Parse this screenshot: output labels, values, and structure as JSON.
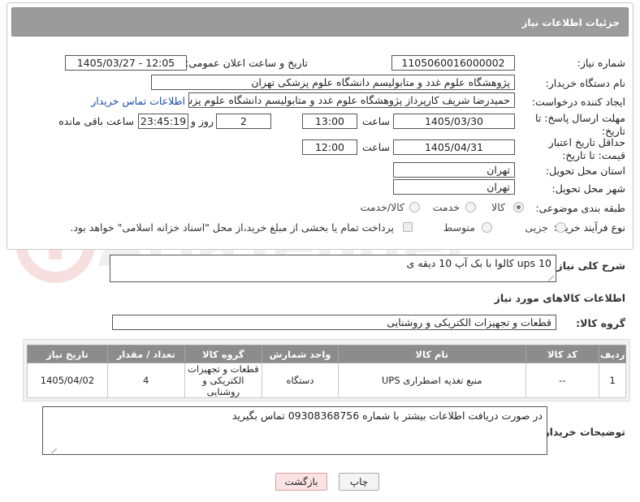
{
  "header": {
    "title": "جزئیات اطلاعات نیاز"
  },
  "fields": {
    "need_number_label": "شماره نیاز:",
    "need_number": "1105060016000002",
    "announce_label": "تاریخ و ساعت اعلان عمومی:",
    "announce_value": "1405/03/27 - 12:05",
    "buyer_org_label": "نام دستگاه خریدار:",
    "buyer_org": "پژوهشگاه علوم غدد و متابولیسم دانشگاه علوم پزشکی تهران",
    "requester_label": "ایجاد کننده درخواست:",
    "requester": "حمیدرضا شریف کارپرداز پژوهشگاه علوم غدد و متابولیسم دانشگاه علوم پزشکی",
    "buyer_contact_link": "اطلاعات تماس خریدار",
    "deadline_label": "مهلت ارسال پاسخ: تا تاریخ:",
    "deadline_date": "1405/03/30",
    "time_label": "ساعت",
    "deadline_time": "13:00",
    "days": "2",
    "days_label": "روز و",
    "remaining": "23:45:19",
    "remaining_label": "ساعت باقی مانده",
    "min_price_label": "حداقل تاریخ اعتبار قیمت: تا تاریخ:",
    "min_price_date": "1405/04/31",
    "min_price_time": "12:00",
    "province_label": "استان محل تحویل:",
    "province": "تهران",
    "city_label": "شهر محل تحویل:",
    "city": "تهران",
    "category_label": "طبقه بندی موضوعی:",
    "category_options": [
      "کالا",
      "خدمت",
      "کالا/خدمت"
    ],
    "process_label": "نوع فرآیند خرید :",
    "process_options": [
      "جزیی",
      "متوسط"
    ],
    "payment_note": "پرداخت تمام یا بخشی از مبلغ خرید،از محل \"اسناد خزانه اسلامی\" خواهد بود."
  },
  "description": {
    "label": "شرح کلی نیاز:",
    "value": "ups 10 کالوا با بک آپ 10 دیقه ی"
  },
  "goods_info_title": "اطلاعات کالاهای مورد نیاز",
  "goods_group": {
    "label": "گروه کالا:",
    "value": "قطعات و تجهیزات الکتریکی و روشنایی"
  },
  "table": {
    "headers": [
      "ردیف",
      "کد کالا",
      "نام کالا",
      "واحد شمارش",
      "گروه کالا",
      "تعداد / مقدار",
      "تاریخ نیاز"
    ],
    "rows": [
      {
        "row": "1",
        "code": "--",
        "name": "منبع تغذیه اضطراری UPS",
        "unit": "دستگاه",
        "group": "قطعات و تجهیزات الکتریکی و روشنایی",
        "qty": "4",
        "date": "1405/04/02"
      }
    ]
  },
  "buyer_notes": {
    "label": "توضیحات خریدار:",
    "value": "در صورت دریافت اطلاعات بیشتر با شماره 09308368756 تماس بگیرید"
  },
  "buttons": {
    "print": "چاپ",
    "back": "بازگشت"
  },
  "watermark_text": "AriaTender.net",
  "colors": {
    "header_bg": "#9b9b9b",
    "table_header_bg": "#8c8c8c",
    "back_button_bg": "#fbe3e3",
    "link": "#1a4fa8"
  }
}
